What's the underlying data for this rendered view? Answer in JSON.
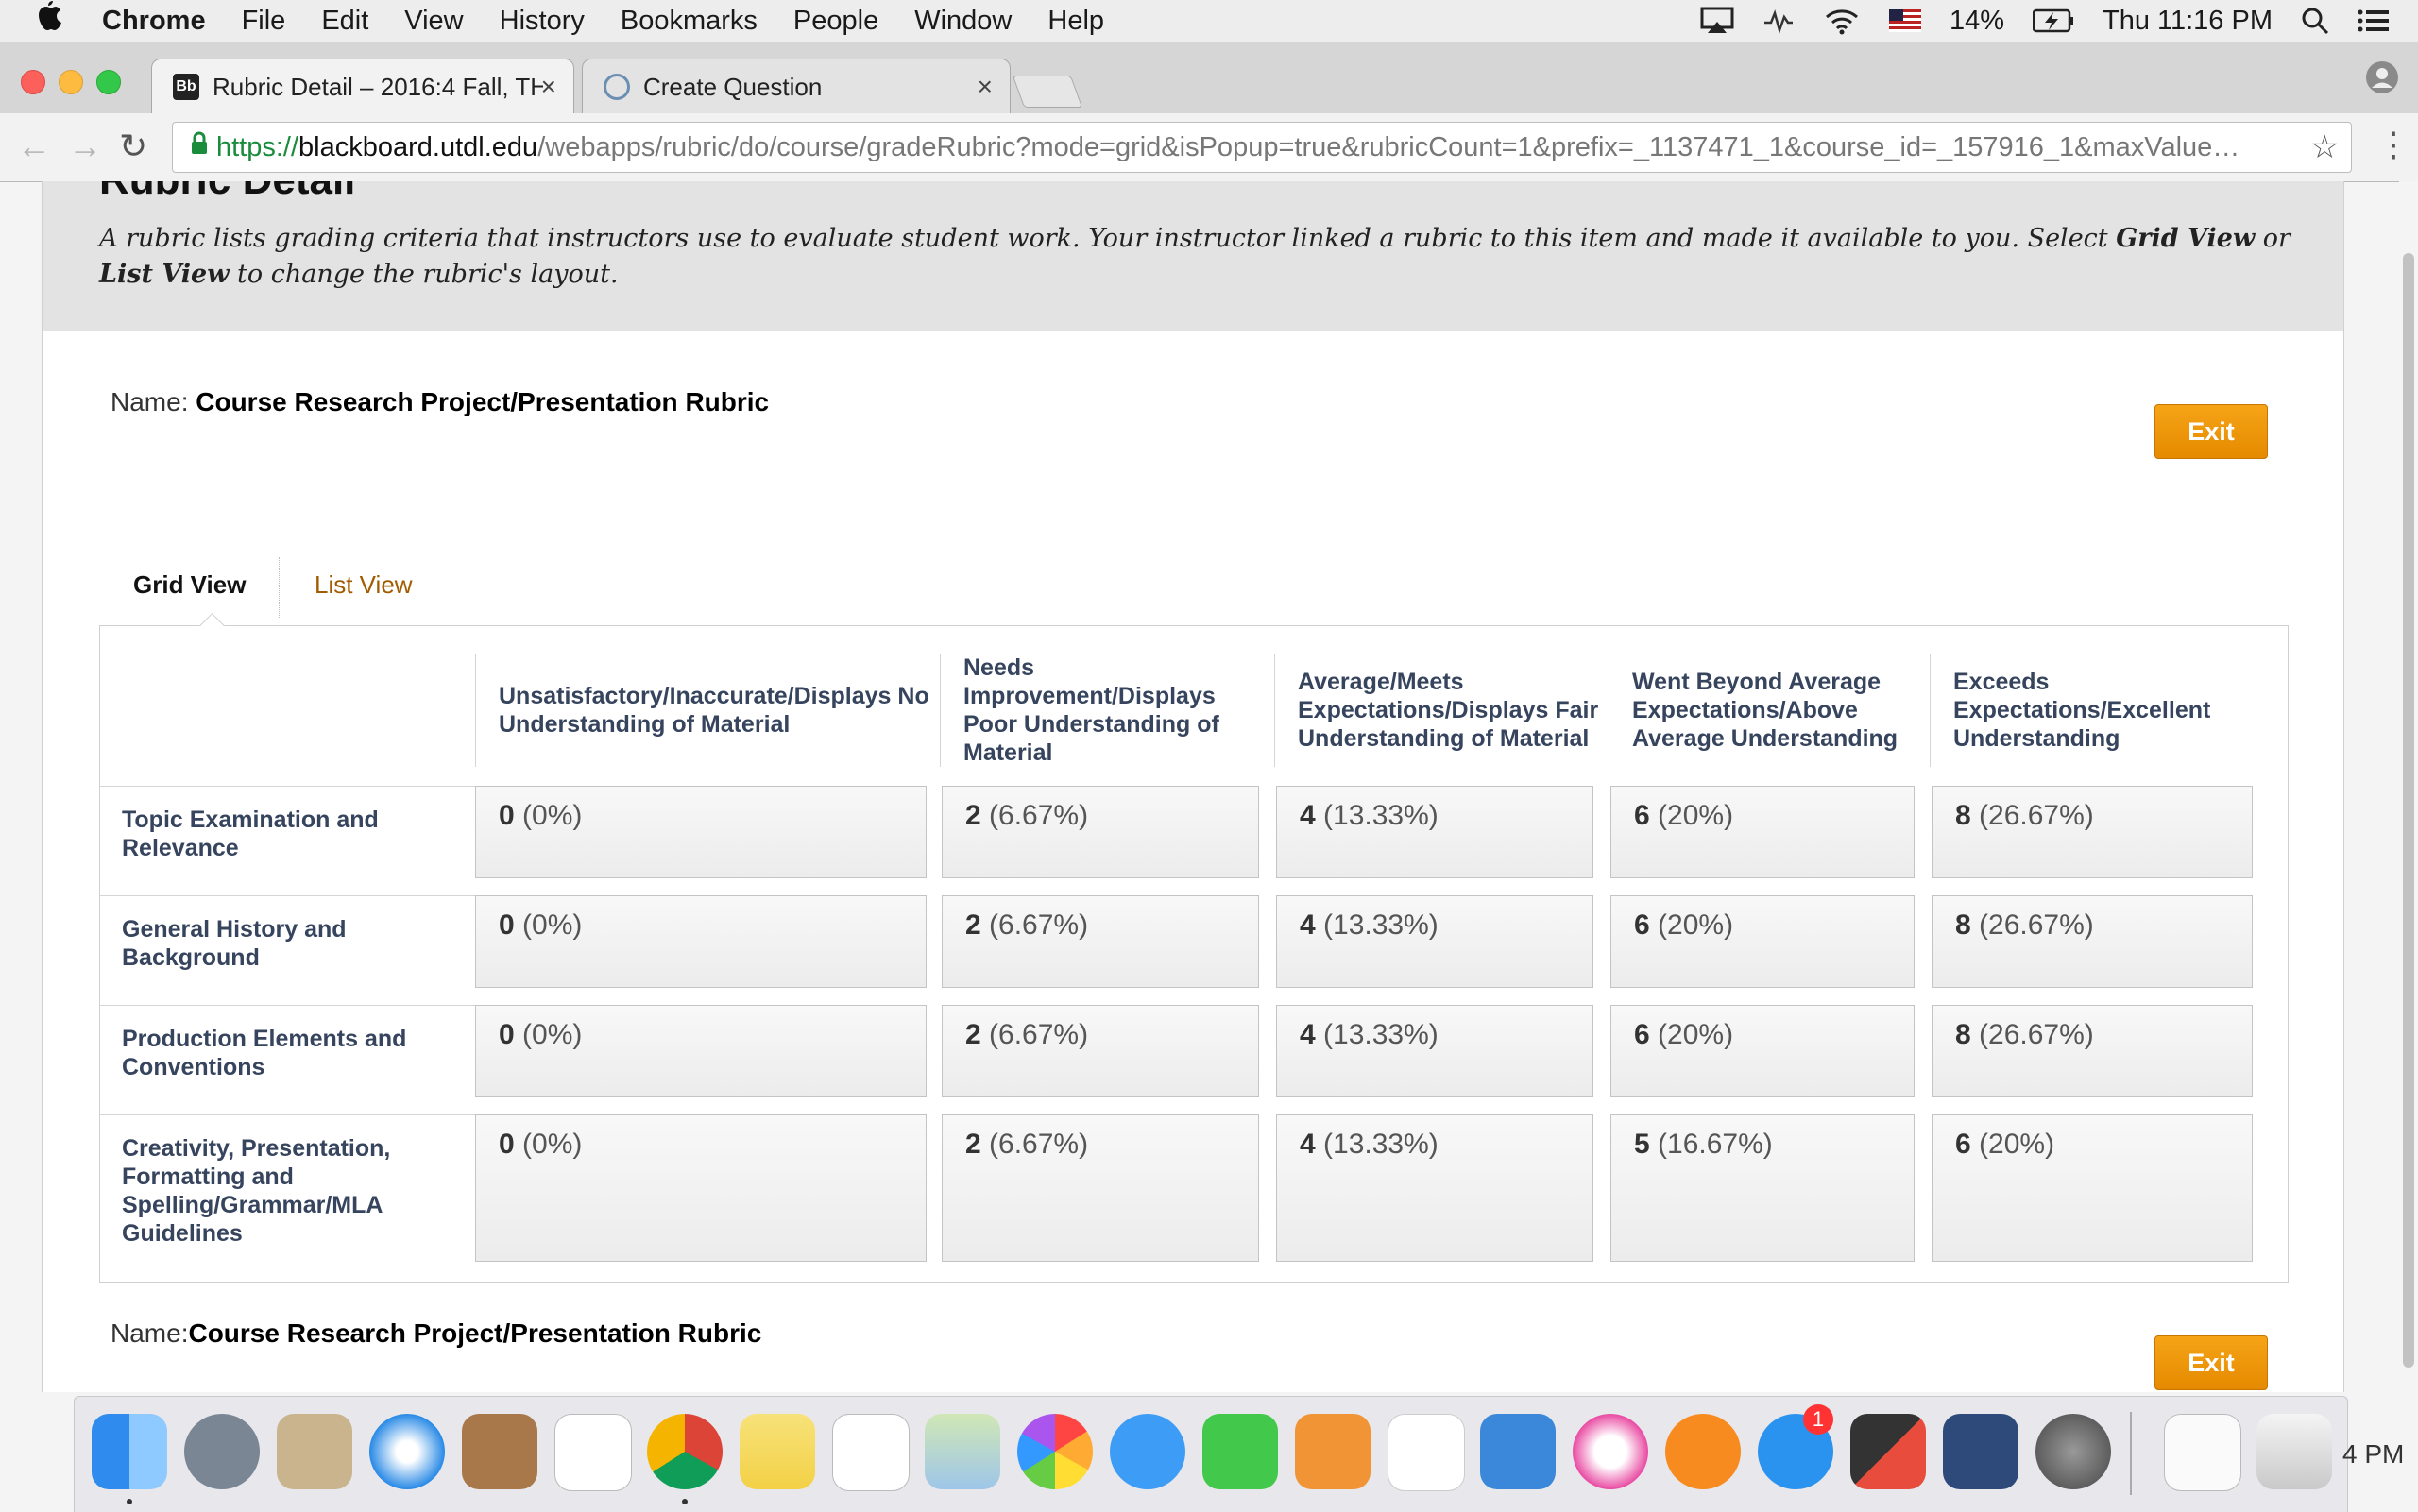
{
  "menubar": {
    "app": "Chrome",
    "items": [
      "File",
      "Edit",
      "View",
      "History",
      "Bookmarks",
      "People",
      "Window",
      "Help"
    ],
    "battery": "14%",
    "clock": "Thu 11:16 PM"
  },
  "tabs": [
    {
      "title": "Rubric Detail – 2016:4 Fall, TH",
      "active": true
    },
    {
      "title": "Create Question",
      "active": false
    }
  ],
  "address": {
    "protocol": "https://",
    "host": "blackboard.utdl.edu",
    "path": "/webapps/rubric/do/course/gradeRubric?mode=grid&isPopup=true&rubricCount=1&prefix=_1137471_1&course_id=_157916_1&maxValue…"
  },
  "page": {
    "title": "Rubric Detail",
    "intro_prefix": "A rubric lists grading criteria that instructors use to evaluate student work. Your instructor linked a rubric to this item and made it available to you. Select ",
    "intro_grid": "Grid View",
    "intro_or": " or ",
    "intro_list": "List View",
    "intro_suffix": " to change the rubric's layout.",
    "name_label": "Name:",
    "rubric_name": "Course Research Project/Presentation Rubric",
    "exit_label": "Exit",
    "view_tabs": {
      "grid": "Grid View",
      "list": "List View"
    }
  },
  "rubric": {
    "columns": [
      "Unsatisfactory/Inaccurate/Displays No Understanding of Material",
      "Needs Improvement/Displays Poor Understanding of Material",
      "Average/Meets Expectations/Displays Fair Understanding of Material",
      "Went Beyond Average Expectations/Above Average Understanding",
      "Exceeds Expectations/Excellent Understanding"
    ],
    "rows": [
      {
        "criterion": "Topic Examination and Relevance",
        "cells": [
          {
            "points": "0",
            "pct": "(0%)"
          },
          {
            "points": "2",
            "pct": "(6.67%)"
          },
          {
            "points": "4",
            "pct": "(13.33%)"
          },
          {
            "points": "6",
            "pct": "(20%)"
          },
          {
            "points": "8",
            "pct": "(26.67%)"
          }
        ]
      },
      {
        "criterion": "General History and Background",
        "cells": [
          {
            "points": "0",
            "pct": "(0%)"
          },
          {
            "points": "2",
            "pct": "(6.67%)"
          },
          {
            "points": "4",
            "pct": "(13.33%)"
          },
          {
            "points": "6",
            "pct": "(20%)"
          },
          {
            "points": "8",
            "pct": "(26.67%)"
          }
        ]
      },
      {
        "criterion": "Production Elements and Conventions",
        "cells": [
          {
            "points": "0",
            "pct": "(0%)"
          },
          {
            "points": "2",
            "pct": "(6.67%)"
          },
          {
            "points": "4",
            "pct": "(13.33%)"
          },
          {
            "points": "6",
            "pct": "(20%)"
          },
          {
            "points": "8",
            "pct": "(26.67%)"
          }
        ]
      },
      {
        "criterion": "Creativity, Presentation, Formatting and Spelling/Grammar/MLA Guidelines",
        "cells": [
          {
            "points": "0",
            "pct": "(0%)"
          },
          {
            "points": "2",
            "pct": "(6.67%)"
          },
          {
            "points": "4",
            "pct": "(13.33%)"
          },
          {
            "points": "5",
            "pct": "(16.67%)"
          },
          {
            "points": "6",
            "pct": "(20%)"
          }
        ]
      }
    ]
  },
  "dock": {
    "clock_peek": "4 PM",
    "badge": "1",
    "apps": [
      "finder-icon",
      "launchpad-icon",
      "mail-icon",
      "safari-icon",
      "contacts-icon",
      "calendar-icon",
      "chrome-icon",
      "notes-icon",
      "reminders-icon",
      "maps-icon",
      "photos-icon",
      "messages-icon",
      "facetime-icon",
      "pages-icon",
      "numbers-icon",
      "keynote-icon",
      "itunes-icon",
      "ibooks-icon",
      "app-store-icon",
      "unknown-app-icon",
      "imovie-icon",
      "system-preferences-icon",
      "documents-icon",
      "trash-icon"
    ]
  }
}
